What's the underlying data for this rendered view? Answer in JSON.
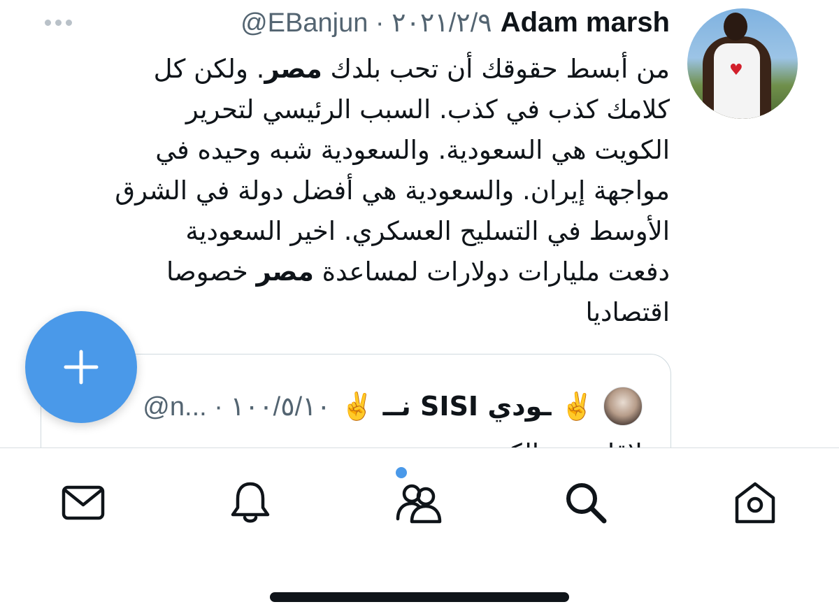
{
  "tweet": {
    "author_name": "Adam marsh",
    "author_meta": "@EBanjun · ٢٠٢١/٢/٩",
    "more_icon": "more-dots-icon",
    "body_lines": [
      [
        "من أبسط حقوقك أن تحب بلدك ",
        "مصر",
        ". ولكن كل"
      ],
      [
        "كلامك كذب في كذب. السبب الرئيسي لتحرير"
      ],
      [
        "الكويت هي السعودية. والسعودية شبه وحيده في"
      ],
      [
        "مواجهة إيران. والسعودية هي أفضل دولة في الشرق"
      ],
      [
        "الأوسط في التسليح العسكري. اخير السعودية"
      ],
      [
        "دفعت مليارات دولارات لمساعدة ",
        "مصر",
        " خصوصا"
      ],
      [
        "اقتصاديا"
      ]
    ],
    "colors": {
      "text": "#0f1419",
      "secondary": "#536471",
      "accent": "#4a99e9"
    }
  },
  "quote": {
    "name": "✌️ نــ SISI ـودي ✌️",
    "meta": "@n... · ١٠٠/٥/١٠",
    "text": "لاقات مع الكويت"
  },
  "fab": {
    "icon": "plus-icon"
  },
  "tabbar": {
    "tabs": [
      {
        "name": "messages",
        "icon": "mail-icon"
      },
      {
        "name": "notifications",
        "icon": "bell-icon"
      },
      {
        "name": "communities",
        "icon": "people-icon"
      },
      {
        "name": "search",
        "icon": "search-icon"
      },
      {
        "name": "home",
        "icon": "home-icon"
      }
    ]
  }
}
